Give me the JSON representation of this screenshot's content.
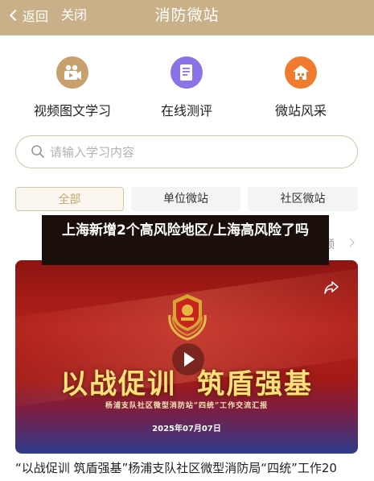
{
  "header": {
    "back_label": "返回",
    "close_label": "关闭",
    "title": "消防微站"
  },
  "features": [
    {
      "label": "视频图文学习",
      "icon": "video-icon",
      "color": "#c7a06b"
    },
    {
      "label": "在线测评",
      "icon": "document-icon",
      "color": "#8b73e6"
    },
    {
      "label": "微站风采",
      "icon": "home-icon",
      "color": "#f07a2e"
    }
  ],
  "search": {
    "placeholder": "请输入学习内容"
  },
  "tabs": [
    "全部",
    "单位微站",
    "社区微站"
  ],
  "overlay_title": "上海新增2个高风险地区/上海高风险了吗",
  "more_fragment": "频",
  "card": {
    "slogan_left": "以战促训",
    "slogan_right": "筑盾强基",
    "subline": "杨浦支队社区微型消防站“四统”工作交流汇报",
    "date": "2025年07月07日"
  },
  "caption": "“以战促训 筑盾强基”杨浦支队社区微型消防局“四统”工作20",
  "colors": {
    "header_bg": "#c9b088",
    "accent": "#c9a46d"
  }
}
